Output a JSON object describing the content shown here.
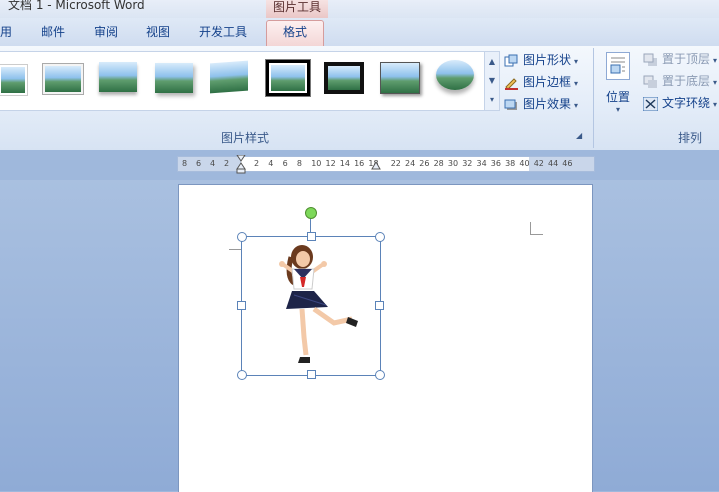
{
  "window": {
    "title": "文档 1 - Microsoft Word",
    "contextual_tab_group": "图片工具"
  },
  "tabs": [
    {
      "label": "用"
    },
    {
      "label": "邮件"
    },
    {
      "label": "审阅"
    },
    {
      "label": "视图"
    },
    {
      "label": "开发工具"
    },
    {
      "label": "格式",
      "active": true
    }
  ],
  "ribbon": {
    "picture_styles_group": "图片样式",
    "arrange_group": "排列",
    "commands": {
      "shape": "图片形状",
      "border": "图片边框",
      "effects": "图片效果",
      "position": "位置",
      "bring_front": "置于顶层",
      "send_back": "置于底层",
      "text_wrap": "文字环绕"
    }
  },
  "ruler": {
    "left_numbers": [
      "8",
      "6",
      "4",
      "2"
    ],
    "right_numbers": [
      "2",
      "4",
      "6",
      "8",
      "10",
      "12",
      "14",
      "16",
      "18",
      "22",
      "24",
      "26",
      "28",
      "30",
      "32",
      "34",
      "36",
      "38",
      "40",
      "42",
      "44",
      "46"
    ]
  },
  "colors": {
    "accent": "#15428b",
    "contextual": "#eac7c7",
    "rotate_handle": "#7dd85a"
  },
  "icons": [
    "picture-shape-icon",
    "picture-border-icon",
    "picture-effects-icon",
    "position-icon",
    "bring-front-icon",
    "send-back-icon",
    "text-wrap-icon"
  ]
}
